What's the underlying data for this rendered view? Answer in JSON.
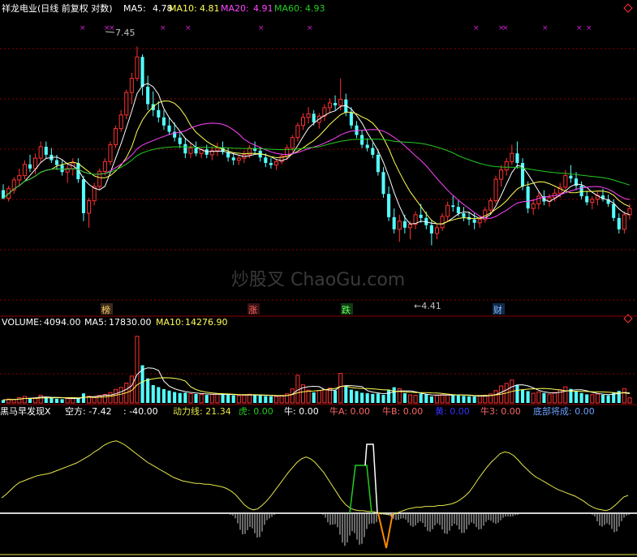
{
  "colors": {
    "background": "#000000",
    "up": "#ff3232",
    "down": "#54ffff",
    "ma5": "#ffffff",
    "ma10": "#ffff55",
    "ma20": "#ff44ff",
    "ma60": "#22cc22",
    "grid": "#8b0000",
    "text_label": "#c0c0c0",
    "marker": "#d020d0",
    "ind_line": "#e6e64a",
    "ind_bar": "#cfcfcf",
    "ind_base": "#d0d0d0"
  },
  "header": {
    "title": "祥龙电业(日线 前复权 对数)",
    "ma5_label": "MA5:",
    "ma5_value": "4.78",
    "ma10_label": "MA10:",
    "ma10_value": "4.81",
    "ma20_label": "MA20:",
    "ma20_value": "4.91",
    "ma60_label": "MA60:",
    "ma60_value": "4.93"
  },
  "volume_header": {
    "label": "VOLUME:",
    "value": "4094.00",
    "ma5_label": "MA5:",
    "ma5_value": "17830.00",
    "ma10_label": "MA10:",
    "ma10_value": "14276.90"
  },
  "indicator_header": {
    "name": "黑马早发现X",
    "items": [
      {
        "label": "空方:",
        "value": "-7.42",
        "color": "#ffffff"
      },
      {
        "label": ":",
        "value": "-40.00",
        "color": "#ffffff"
      },
      {
        "label": "动力线:",
        "value": "21.34",
        "color": "#e6e64a"
      },
      {
        "label": "虎:",
        "value": "0.00",
        "color": "#22cc22"
      },
      {
        "label": "牛:",
        "value": "0.00",
        "color": "#ffffff"
      },
      {
        "label": "牛A:",
        "value": "0.00",
        "color": "#ff6666"
      },
      {
        "label": "牛B:",
        "value": "0.00",
        "color": "#ff6666"
      },
      {
        "label": "黄:",
        "value": "0.00",
        "color": "#3333ff"
      },
      {
        "label": "牛3:",
        "value": "0.00",
        "color": "#ff6666"
      },
      {
        "label": "底部将成:",
        "value": "0.00",
        "color": "#6aa0ff"
      }
    ]
  },
  "watermark": "炒股叉 ChaoGu.com",
  "annotations": {
    "high": "7.45",
    "low": "←4.41",
    "events": [
      "榜",
      "涨",
      "跌",
      "财"
    ]
  },
  "chart_data": [
    {
      "type": "candlestick",
      "title": "祥龙电业(日线 前复权 对数)",
      "scale": "log",
      "ylim": [
        3.9,
        7.8
      ],
      "grid": true,
      "ohlc": [
        [
          5.1,
          5.18,
          4.98,
          4.99
        ],
        [
          4.99,
          5.16,
          4.95,
          5.12
        ],
        [
          5.1,
          5.28,
          5.05,
          5.24
        ],
        [
          5.24,
          5.4,
          5.15,
          5.3
        ],
        [
          5.3,
          5.52,
          5.25,
          5.46
        ],
        [
          5.46,
          5.6,
          5.35,
          5.4
        ],
        [
          5.4,
          5.62,
          5.32,
          5.55
        ],
        [
          5.55,
          5.8,
          5.48,
          5.72
        ],
        [
          5.72,
          5.8,
          5.55,
          5.6
        ],
        [
          5.6,
          5.7,
          5.48,
          5.52
        ],
        [
          5.52,
          5.6,
          5.38,
          5.45
        ],
        [
          5.45,
          5.52,
          5.3,
          5.35
        ],
        [
          5.35,
          5.45,
          5.2,
          5.4
        ],
        [
          5.4,
          5.55,
          5.3,
          5.48
        ],
        [
          5.48,
          5.55,
          5.2,
          5.25
        ],
        [
          5.25,
          5.3,
          4.7,
          4.8
        ],
        [
          4.8,
          5.0,
          4.62,
          4.96
        ],
        [
          4.96,
          5.2,
          4.9,
          5.15
        ],
        [
          5.15,
          5.4,
          5.1,
          5.36
        ],
        [
          5.36,
          5.55,
          5.3,
          5.5
        ],
        [
          5.5,
          5.8,
          5.45,
          5.75
        ],
        [
          5.75,
          6.05,
          5.7,
          6.0
        ],
        [
          6.0,
          6.3,
          5.95,
          6.22
        ],
        [
          6.22,
          6.65,
          6.15,
          6.6
        ],
        [
          6.6,
          6.95,
          6.4,
          6.85
        ],
        [
          6.85,
          7.45,
          6.8,
          7.25
        ],
        [
          7.25,
          7.3,
          6.55,
          6.7
        ],
        [
          6.7,
          6.9,
          6.3,
          6.4
        ],
        [
          6.4,
          6.62,
          6.2,
          6.3
        ],
        [
          6.3,
          6.45,
          6.1,
          6.18
        ],
        [
          6.18,
          6.3,
          5.98,
          6.05
        ],
        [
          6.05,
          6.18,
          5.9,
          5.95
        ],
        [
          5.95,
          6.1,
          5.8,
          5.86
        ],
        [
          5.86,
          5.95,
          5.7,
          5.76
        ],
        [
          5.76,
          5.85,
          5.55,
          5.62
        ],
        [
          5.62,
          5.78,
          5.55,
          5.7
        ],
        [
          5.7,
          5.8,
          5.58,
          5.62
        ],
        [
          5.62,
          5.7,
          5.55,
          5.68
        ],
        [
          5.68,
          5.75,
          5.55,
          5.6
        ],
        [
          5.6,
          5.72,
          5.52,
          5.66
        ],
        [
          5.66,
          5.78,
          5.58,
          5.7
        ],
        [
          5.7,
          5.8,
          5.6,
          5.64
        ],
        [
          5.64,
          5.7,
          5.5,
          5.56
        ],
        [
          5.56,
          5.62,
          5.45,
          5.52
        ],
        [
          5.52,
          5.6,
          5.45,
          5.55
        ],
        [
          5.55,
          5.66,
          5.48,
          5.6
        ],
        [
          5.6,
          5.75,
          5.55,
          5.7
        ],
        [
          5.7,
          5.8,
          5.6,
          5.66
        ],
        [
          5.66,
          5.72,
          5.5,
          5.56
        ],
        [
          5.56,
          5.62,
          5.42,
          5.48
        ],
        [
          5.48,
          5.55,
          5.4,
          5.45
        ],
        [
          5.45,
          5.52,
          5.38,
          5.5
        ],
        [
          5.5,
          5.62,
          5.46,
          5.58
        ],
        [
          5.58,
          5.75,
          5.52,
          5.7
        ],
        [
          5.7,
          5.9,
          5.65,
          5.86
        ],
        [
          5.86,
          6.1,
          5.8,
          6.05
        ],
        [
          6.05,
          6.25,
          5.98,
          6.18
        ],
        [
          6.18,
          6.35,
          6.08,
          6.24
        ],
        [
          6.24,
          6.3,
          6.05,
          6.1
        ],
        [
          6.1,
          6.25,
          6.0,
          6.2
        ],
        [
          6.2,
          6.4,
          6.12,
          6.34
        ],
        [
          6.34,
          6.5,
          6.25,
          6.42
        ],
        [
          6.42,
          6.55,
          6.3,
          6.38
        ],
        [
          6.38,
          6.85,
          6.3,
          6.48
        ],
        [
          6.48,
          6.58,
          6.2,
          6.26
        ],
        [
          6.26,
          6.35,
          6.0,
          6.05
        ],
        [
          6.05,
          6.12,
          5.85,
          5.9
        ],
        [
          5.9,
          5.98,
          5.7,
          5.75
        ],
        [
          5.75,
          5.85,
          5.65,
          5.7
        ],
        [
          5.7,
          5.78,
          5.55,
          5.6
        ],
        [
          5.6,
          5.68,
          5.3,
          5.35
        ],
        [
          5.35,
          5.42,
          5.0,
          5.05
        ],
        [
          5.05,
          5.15,
          4.7,
          4.75
        ],
        [
          4.75,
          4.86,
          4.55,
          4.6
        ],
        [
          4.6,
          4.78,
          4.45,
          4.7
        ],
        [
          4.7,
          4.78,
          4.55,
          4.62
        ],
        [
          4.62,
          4.7,
          4.48,
          4.66
        ],
        [
          4.66,
          4.82,
          4.6,
          4.78
        ],
        [
          4.78,
          4.92,
          4.68,
          4.74
        ],
        [
          4.74,
          4.82,
          4.6,
          4.65
        ],
        [
          4.65,
          4.72,
          4.41,
          4.55
        ],
        [
          4.55,
          4.66,
          4.48,
          4.62
        ],
        [
          4.62,
          4.8,
          4.58,
          4.76
        ],
        [
          4.76,
          4.95,
          4.7,
          4.9
        ],
        [
          4.9,
          5.02,
          4.82,
          4.88
        ],
        [
          4.88,
          4.96,
          4.76,
          4.8
        ],
        [
          4.8,
          4.88,
          4.7,
          4.75
        ],
        [
          4.75,
          4.82,
          4.65,
          4.72
        ],
        [
          4.72,
          4.8,
          4.6,
          4.68
        ],
        [
          4.68,
          4.76,
          4.62,
          4.72
        ],
        [
          4.72,
          4.88,
          4.68,
          4.84
        ],
        [
          4.84,
          5.0,
          4.8,
          4.96
        ],
        [
          4.96,
          5.3,
          4.92,
          5.25
        ],
        [
          5.25,
          5.45,
          5.15,
          5.38
        ],
        [
          5.38,
          5.55,
          5.3,
          5.5
        ],
        [
          5.5,
          5.75,
          5.45,
          5.62
        ],
        [
          5.62,
          5.8,
          5.4,
          5.48
        ],
        [
          5.48,
          5.55,
          5.1,
          5.15
        ],
        [
          5.15,
          5.22,
          4.8,
          4.86
        ],
        [
          4.86,
          4.98,
          4.78,
          4.92
        ],
        [
          4.92,
          5.08,
          4.85,
          5.02
        ],
        [
          5.02,
          5.1,
          4.9,
          4.95
        ],
        [
          4.95,
          5.05,
          4.88,
          5.0
        ],
        [
          5.0,
          5.12,
          4.95,
          5.06
        ],
        [
          5.06,
          5.2,
          5.0,
          5.14
        ],
        [
          5.14,
          5.38,
          5.1,
          5.3
        ],
        [
          5.3,
          5.45,
          5.2,
          5.26
        ],
        [
          5.26,
          5.35,
          5.1,
          5.16
        ],
        [
          5.16,
          5.22,
          4.98,
          5.02
        ],
        [
          5.02,
          5.08,
          4.9,
          4.94
        ],
        [
          4.94,
          5.02,
          4.85,
          4.98
        ],
        [
          4.98,
          5.08,
          4.9,
          5.03
        ],
        [
          5.03,
          5.12,
          4.95,
          4.98
        ],
        [
          4.98,
          5.04,
          4.88,
          4.92
        ],
        [
          4.92,
          4.98,
          4.7,
          4.74
        ],
        [
          4.74,
          4.8,
          4.55,
          4.6
        ],
        [
          4.6,
          4.82,
          4.55,
          4.78
        ],
        [
          4.78,
          4.92,
          4.72,
          4.86
        ]
      ],
      "ma_series": [
        {
          "name": "MA5",
          "period": 5
        },
        {
          "name": "MA10",
          "period": 10
        },
        {
          "name": "MA20",
          "period": 20
        },
        {
          "name": "MA60",
          "period": 60
        }
      ]
    },
    {
      "type": "bar",
      "title": "VOLUME",
      "ylim": [
        0,
        60000
      ],
      "values": [
        2400,
        3100,
        2800,
        4200,
        5200,
        3600,
        4100,
        6200,
        4800,
        3900,
        3300,
        3000,
        3500,
        4200,
        3700,
        7600,
        5400,
        4700,
        6000,
        6800,
        8300,
        10800,
        12400,
        15800,
        21400,
        53000,
        30000,
        19500,
        14200,
        12600,
        11000,
        9800,
        8700,
        7900,
        8200,
        7400,
        7100,
        6800,
        6400,
        6900,
        7200,
        7000,
        6500,
        6100,
        5800,
        6200,
        6900,
        6300,
        5900,
        5500,
        5300,
        5100,
        5900,
        7300,
        11200,
        22000,
        14400,
        10100,
        8400,
        9800,
        10600,
        11800,
        9900,
        23500,
        13200,
        10600,
        9500,
        8100,
        7700,
        7200,
        7500,
        6400,
        10200,
        12500,
        11300,
        7800,
        6400,
        6100,
        7400,
        6800,
        5200,
        5900,
        6600,
        7100,
        6500,
        6000,
        5600,
        5300,
        5100,
        5400,
        6000,
        7200,
        9800,
        13500,
        15600,
        18200,
        14400,
        10400,
        9400,
        7700,
        8800,
        7900,
        7100,
        8300,
        10600,
        12800,
        11200,
        9600,
        7900,
        6800,
        6600,
        7200,
        6500,
        6100,
        8200,
        9600,
        11400,
        4094
      ],
      "series": [
        {
          "name": "VOLUME"
        },
        {
          "name": "MA5"
        },
        {
          "name": "MA10"
        }
      ]
    },
    {
      "type": "line",
      "title": "黑马早发现X",
      "series": [
        {
          "name": "动力线",
          "values": [
            18,
            22,
            27,
            32,
            36,
            38,
            40,
            42,
            44,
            45,
            46,
            47,
            49,
            51,
            53,
            55,
            57,
            59,
            62,
            65,
            68,
            72,
            75,
            79,
            82,
            84,
            85,
            83,
            80,
            76,
            72,
            68,
            64,
            60,
            57,
            54,
            51,
            48,
            45,
            42,
            40,
            38,
            37,
            36,
            35,
            35,
            34,
            34,
            33,
            32,
            31,
            29,
            26,
            22,
            16,
            10,
            6,
            4,
            5,
            9,
            14,
            20,
            27,
            34,
            41,
            48,
            54,
            60,
            64,
            66,
            64,
            60,
            54,
            48,
            40,
            32,
            24,
            16,
            10,
            6,
            4,
            3,
            3,
            2,
            2,
            1,
            0,
            -1,
            -2,
            -1,
            1,
            3,
            5,
            6,
            7,
            7,
            8,
            8,
            8,
            9,
            9,
            10,
            11,
            13,
            16,
            20,
            25,
            32,
            40,
            47,
            54,
            60,
            65,
            70,
            72,
            71,
            68,
            63,
            57,
            52,
            47,
            43,
            40,
            37,
            34,
            31,
            28,
            26,
            24,
            22,
            20,
            17,
            14,
            10,
            7,
            5,
            4,
            3,
            5,
            9,
            14,
            19,
            21
          ]
        },
        {
          "name": "虎",
          "values": []
        }
      ]
    }
  ]
}
